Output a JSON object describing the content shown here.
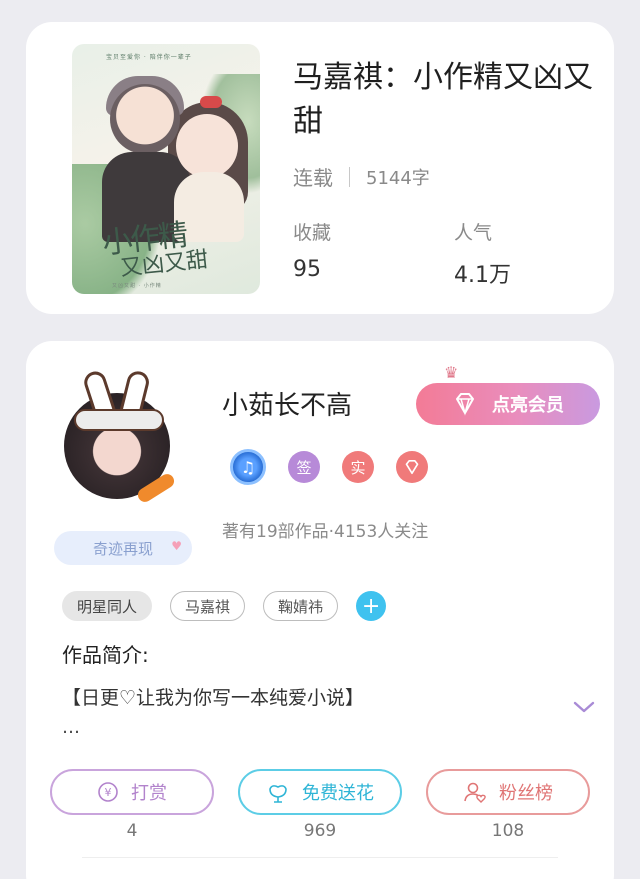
{
  "book": {
    "title": "马嘉祺：小作精又凶又甜",
    "status": "连载",
    "word_count": "5144字",
    "favorites_label": "收藏",
    "favorites_value": "95",
    "popularity_label": "人气",
    "popularity_value": "4.1万",
    "cover": {
      "title_line1": "小作精",
      "title_line2": "又凶又甜",
      "top_text": "宝贝至爱你 · 陪伴你一辈子",
      "bottom_text": "又凶又甜 · 小作精"
    }
  },
  "author": {
    "name": "小茹长不高",
    "vip_button": "点亮会员",
    "badge_miracle": "奇迹再现",
    "badges": [
      {
        "icon": "music-note-icon",
        "text": "♫"
      },
      {
        "icon": "sign-badge",
        "text": "签"
      },
      {
        "icon": "real-badge",
        "text": "实"
      },
      {
        "icon": "diamond-badge",
        "text": ""
      }
    ],
    "stats_line": "著有19部作品·4153人关注"
  },
  "tags": [
    "明星同人",
    "马嘉祺",
    "鞠婧祎"
  ],
  "intro": {
    "label": "作品简介:",
    "text": "【日更♡让我为你写一本纯爱小说】",
    "ellipsis": "…"
  },
  "actions": [
    {
      "label": "打赏",
      "icon": "yen-coin-icon",
      "count": "4"
    },
    {
      "label": "免费送花",
      "icon": "flower-icon",
      "count": "969"
    },
    {
      "label": "粉丝榜",
      "icon": "fan-person-icon",
      "count": "108"
    }
  ],
  "colors": {
    "background": "#ececf1",
    "vip_gradient_start": "#f37b96",
    "vip_gradient_end": "#c99ae0",
    "reward": "#b283cc",
    "flower": "#2fb5d6",
    "fans": "#e07575",
    "tag_add": "#3fc2ef"
  }
}
